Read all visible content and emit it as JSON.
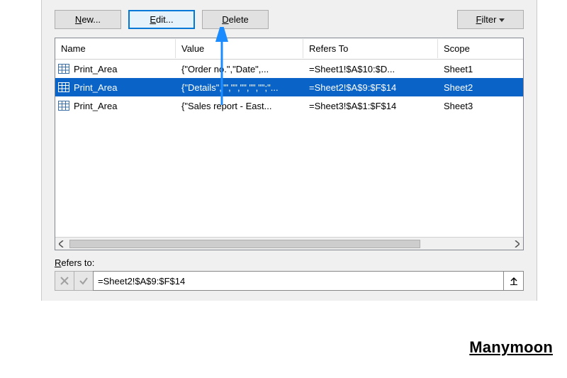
{
  "toolbar": {
    "new_prefix": "N",
    "new_suffix": "ew...",
    "edit_prefix": "E",
    "edit_suffix": "dit...",
    "delete_prefix": "D",
    "delete_suffix": "elete",
    "filter_prefix": "F",
    "filter_suffix": "ilter"
  },
  "columns": {
    "name": "Name",
    "value": "Value",
    "refers_to": "Refers To",
    "scope": "Scope"
  },
  "rows": [
    {
      "name": "Print_Area",
      "value": "{\"Order no.\",\"Date\",...",
      "refers_to": "=Sheet1!$A$10:$D...",
      "scope": "Sheet1",
      "selected": false
    },
    {
      "name": "Print_Area",
      "value": "{\"Details\",\"\",\"\",\"\",\"\",\"\";\"...",
      "refers_to": "=Sheet2!$A$9:$F$14",
      "scope": "Sheet2",
      "selected": true
    },
    {
      "name": "Print_Area",
      "value": "{\"Sales report - East...",
      "refers_to": "=Sheet3!$A$1:$F$14",
      "scope": "Sheet3",
      "selected": false
    }
  ],
  "refers": {
    "label_prefix": "R",
    "label_suffix": "efers to:",
    "value": "=Sheet2!$A$9:$F$14"
  },
  "watermark": "Manymoon",
  "annotation": {
    "arrow_color": "#1a8cff"
  }
}
